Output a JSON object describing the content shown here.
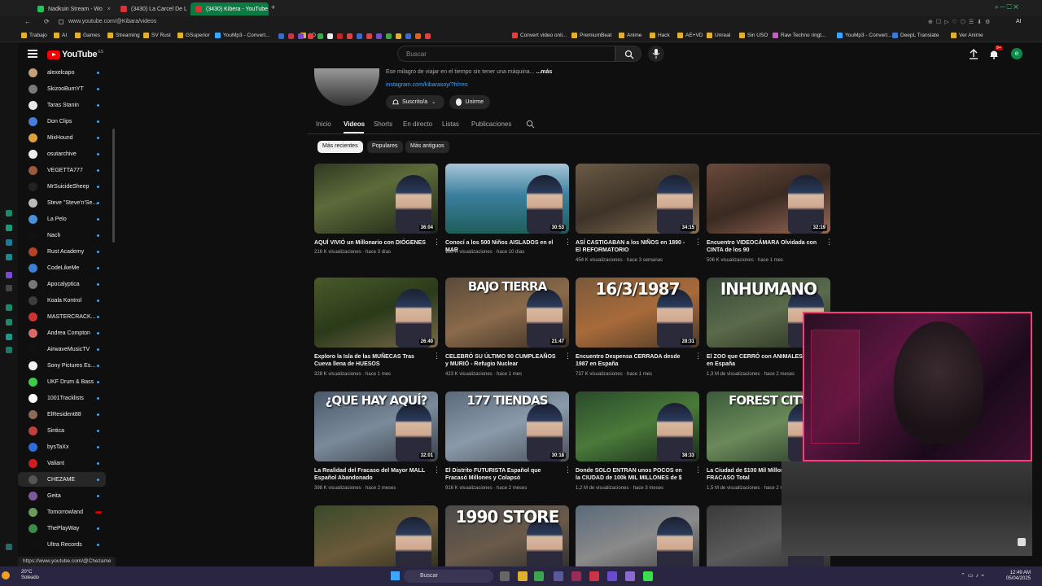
{
  "browser": {
    "tabs": [
      {
        "label": "Nadkuin Stream - Wo",
        "active": false,
        "color": "#21c35b"
      },
      {
        "label": "(3430) La Carcel De L",
        "active": false,
        "color": "#e03030"
      },
      {
        "label": "(3430) Kibera - YouTube",
        "active": true,
        "color": "#e03030"
      }
    ],
    "url": "www.youtube.com/@Kibara/videos",
    "bookmarks": [
      "Trabajo",
      "AI",
      "Games",
      "Streaming",
      "SV Rust",
      "GSuperior",
      "YouMp3 - Convert...",
      "AD",
      "Convert video onli...",
      "PremiumBeat",
      "Anime",
      "Hack",
      "AE+VD",
      "Unreal",
      "Sin USO",
      "Raw Techno ringt...",
      "YouMp3 - Convert...",
      "DeepL Translate",
      "Ver Anime"
    ]
  },
  "youtube": {
    "logo": "YouTube",
    "logo_sup": "ES",
    "search_placeholder": "Buscar",
    "avatar_letter": "e",
    "notif_count": "9+"
  },
  "sidebar": {
    "subs": [
      {
        "name": "alexelcapo",
        "color": "#c4a17a"
      },
      {
        "name": "SkizooBurnYT",
        "color": "#7a7a7a"
      },
      {
        "name": "Taras Stanin",
        "color": "#e8e8e8"
      },
      {
        "name": "Don Clips",
        "color": "#4c7bd9"
      },
      {
        "name": "MixHound",
        "color": "#d8a040"
      },
      {
        "name": "osutarchive",
        "color": "#eeeeee"
      },
      {
        "name": "VEGETTA777",
        "color": "#9b5b3b"
      },
      {
        "name": "MrSuicideSheep",
        "color": "#222222"
      },
      {
        "name": "Steve \"Steve'n'Se...",
        "color": "#bbbbbb"
      },
      {
        "name": "La Pelo",
        "color": "#4a8fd8"
      },
      {
        "name": "Nach",
        "color": "#111111"
      },
      {
        "name": "Rust Academy",
        "color": "#b3442c"
      },
      {
        "name": "CodeLikeMe",
        "color": "#3a7fd0"
      },
      {
        "name": "Apocalyptica",
        "color": "#777777"
      },
      {
        "name": "Koala Kontrol",
        "color": "#3d3d3d"
      },
      {
        "name": "MASTERCRACK...",
        "color": "#cc3333"
      },
      {
        "name": "Andrea Compton",
        "color": "#d86a6a"
      },
      {
        "name": "AirwaveMusicTV",
        "color": "#111111"
      },
      {
        "name": "Sony Pictures Es...",
        "color": "#f1f1f1"
      },
      {
        "name": "UKF Drum & Bass",
        "color": "#43c94a"
      },
      {
        "name": "1001Tracklists",
        "color": "#ffffff"
      },
      {
        "name": "ElResident88",
        "color": "#8a6a5a"
      },
      {
        "name": "Sintica",
        "color": "#c04040"
      },
      {
        "name": "bysTaXx",
        "color": "#2f6ed6"
      },
      {
        "name": "Valiant",
        "color": "#cc1f1f"
      },
      {
        "name": "CHEZAME",
        "color": "#555555"
      },
      {
        "name": "Geita",
        "color": "#7a5a9a"
      },
      {
        "name": "Tomorrowland",
        "color": "#6d9a5a"
      },
      {
        "name": "ThePlayWay",
        "color": "#3a8a4a"
      },
      {
        "name": "Ultra Records",
        "color": "#111111"
      }
    ]
  },
  "channel": {
    "description": "Ese milagro de viajar en el tiempo sin tener una máquina...",
    "more": "...más",
    "link": "instagram.com/kibarasoy/?hl=es",
    "subscribe_label": "Suscrito/a",
    "join_label": "Unirme",
    "tabs": [
      "Inicio",
      "Videos",
      "Shorts",
      "En directo",
      "Listas",
      "Publicaciones"
    ],
    "chips": [
      "Más recientes",
      "Populares",
      "Más antiguos"
    ]
  },
  "videos": [
    {
      "title": "AQUÍ VIVIÓ un Millonario con DIÓGENES",
      "meta": "216 K visualizaciones · hace 3 días",
      "duration": "36:04",
      "bg": "linear-gradient(160deg,#2e3a22,#5d6b3a 40%,#1c2416)"
    },
    {
      "title": "Conocí a los 500 Niños AISLADOS en el MAR",
      "meta": "185 K visualizaciones · hace 10 días",
      "duration": "30:53",
      "bg": "linear-gradient(180deg,#a7c6d8,#3b7f9e 45%,#1e5e5a)"
    },
    {
      "title": "ASÍ CASTIGABAN a los NIÑOS en 1890 - El REFORMATORIO",
      "meta": "454 K visualizaciones · hace 3 semanas",
      "duration": "34:15",
      "bg": "linear-gradient(160deg,#6b5a44,#3d3328 50%,#877055)"
    },
    {
      "title": "Encuentro VIDEOCÁMARA Olvidada con CINTA de los 90",
      "meta": "506 K visualizaciones · hace 1 mes",
      "duration": "32:19",
      "bg": "linear-gradient(160deg,#6a4a3a,#3a2a22 50%,#9a6a55)"
    },
    {
      "title": "Exploro la Isla de las MUÑECAS Tras Cueva llena de HUESOS",
      "meta": "328 K visualizaciones · hace 1 mes",
      "duration": "26:40",
      "bg": "linear-gradient(160deg,#4a5a2a,#2a3a1a 50%,#7a6a4a)"
    },
    {
      "title": "CELEBRÓ SU ÚLTIMO 90 CUMPLEAÑOS y MURIÓ - Refugio Nuclear",
      "meta": "423 K visualizaciones · hace 1 mes",
      "duration": "21:47",
      "bg": "linear-gradient(160deg,#5a4a3a,#8a6a4a 50%,#3a2e24)",
      "overlay": "BAJO TIERRA"
    },
    {
      "title": "Encuentro Despensa CERRADA desde 1987 en España",
      "meta": "737 K visualizaciones · hace 1 mes",
      "duration": "28:31",
      "bg": "linear-gradient(160deg,#7a5a3a,#a86a3a 50%,#4a3a2a)",
      "overlay": "16/3/1987"
    },
    {
      "title": "El ZOO que CERRÓ con ANIMALES DE... en España",
      "meta": "1,3 M de visualizaciones · hace 2 meses",
      "duration": "",
      "bg": "linear-gradient(160deg,#3a4a3a,#5a6a4a 50%,#2a3020)",
      "overlay": "INHUMANO"
    },
    {
      "title": "La Realidad del Fracaso del Mayor MALL Español Abandonado",
      "meta": "398 K visualizaciones · hace 2 meses",
      "duration": "32:01",
      "bg": "linear-gradient(160deg,#4a5a6a,#7a8a9a 50%,#3a4048)",
      "overlay": "¿QUE HAY AQUÍ?"
    },
    {
      "title": "El Distrito FUTURISTA Español que Fracasó Millones y Colapsó",
      "meta": "916 K visualizaciones · hace 2 meses",
      "duration": "30:18",
      "bg": "linear-gradient(160deg,#5a6a7a,#8a9aaa 50%,#4a5058)",
      "overlay": "177 TIENDAS"
    },
    {
      "title": "Donde SOLO ENTRAN unos POCOS en la CIUDAD de 100k MIL MILLONES de $",
      "meta": "1,2 M de visualizaciones · hace 3 meses",
      "duration": "38:33",
      "bg": "linear-gradient(160deg,#2a4a2a,#4a7a3a 50%,#1a2a1a)"
    },
    {
      "title": "La Ciudad de $100 Mil Millones FRACASO Total",
      "meta": "1,5 M de visualizaciones · hace 2 meses",
      "duration": "",
      "bg": "linear-gradient(160deg,#3a5a3a,#6a8a5a 50%,#2a3a2a)",
      "overlay": "FOREST CITY"
    },
    {
      "title": "",
      "meta": "",
      "duration": "",
      "bg": "linear-gradient(160deg,#3a4a2a,#6a5a3a 50%,#2a2a1a)"
    },
    {
      "title": "",
      "meta": "",
      "duration": "",
      "bg": "linear-gradient(160deg,#4a4a4a,#6a5a4a 50%,#2a2a2a)",
      "overlay": "1990 STORE"
    },
    {
      "title": "",
      "meta": "",
      "duration": "",
      "bg": "linear-gradient(160deg,#5a6a7a,#8a8a8a 50%,#3a3a3a)"
    },
    {
      "title": "",
      "meta": "",
      "duration": "",
      "bg": "linear-gradient(160deg,#3a3a3a,#5a5a5a 50%,#2a2a2a)"
    }
  ],
  "status_url": "https://www.youtube.com/@Chezame",
  "taskbar": {
    "weather_temp": "20°C",
    "weather_desc": "Soleado",
    "search_label": "Buscar",
    "time": "12:49 AM",
    "date": "05/04/2025"
  }
}
